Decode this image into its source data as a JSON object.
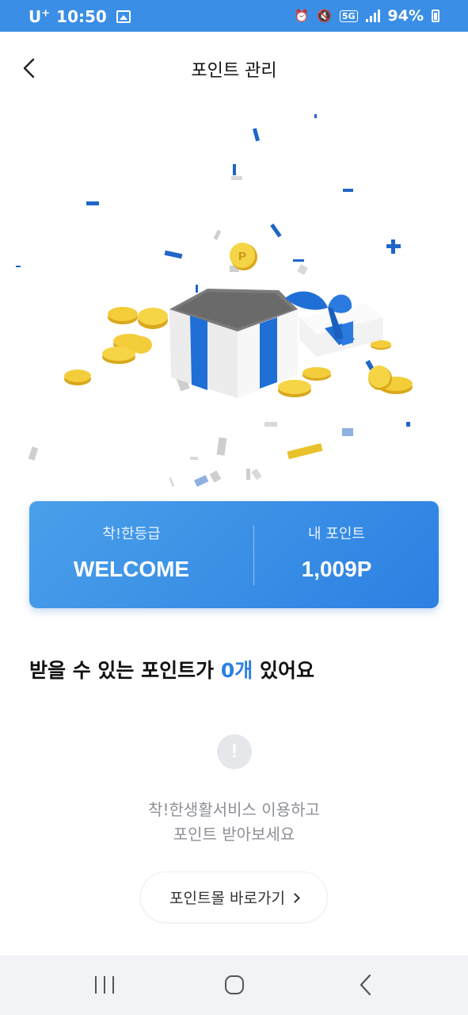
{
  "status_bar": {
    "carrier": "U",
    "carrier_sup": "+",
    "time": "10:50",
    "network": "5G",
    "battery": "94%"
  },
  "header": {
    "title": "포인트 관리"
  },
  "grade_card": {
    "grade_label": "착!한등급",
    "grade_value": "WELCOME",
    "points_label": "내 포인트",
    "points_value": "1,009P"
  },
  "section": {
    "title_prefix": "받을 수 있는 포인트가 ",
    "title_count": "0개",
    "title_suffix": " 있어요"
  },
  "empty_state": {
    "icon_glyph": "!",
    "line1": "착!한생활서비스 이용하고",
    "line2": "포인트 받아보세요",
    "button_label": "포인트몰 바로가기"
  },
  "colors": {
    "accent": "#2c80e2",
    "status_bar": "#3a8ee6",
    "card_gradient_start": "#4aa0ea",
    "card_gradient_end": "#2c80e2"
  }
}
